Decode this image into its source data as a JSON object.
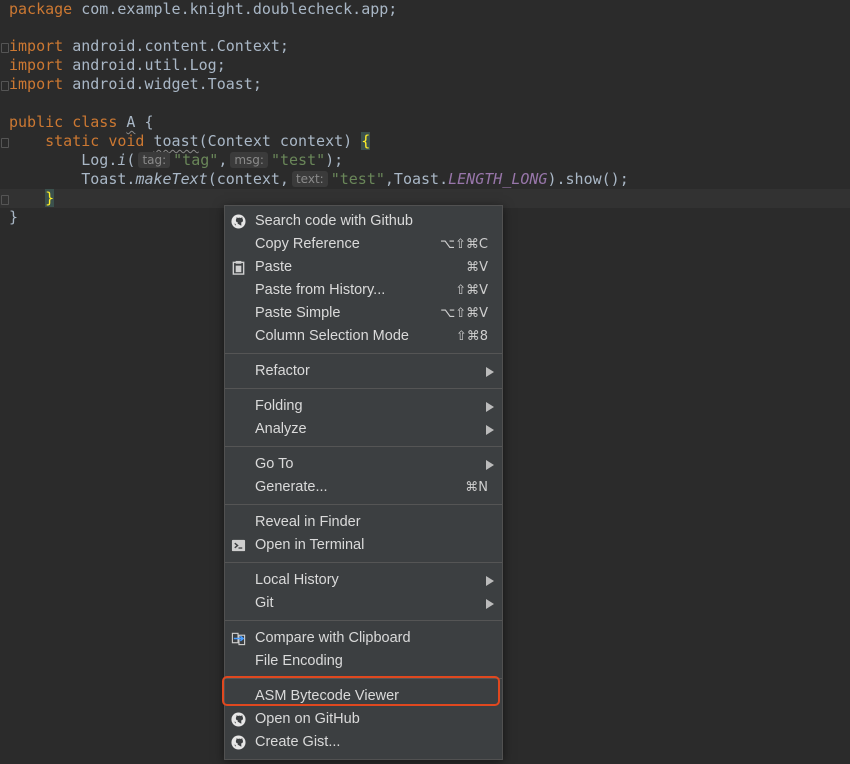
{
  "editor": {
    "line1": {
      "kw": "package",
      "rest": " com.example.knight.doublecheck.app;"
    },
    "imports": [
      {
        "kw": "import",
        "rest": " android.content.Context;"
      },
      {
        "kw": "import",
        "rest": " android.util.Log;"
      },
      {
        "kw": "import",
        "rest": " android.widget.Toast;"
      }
    ],
    "class_line": {
      "kw1": "public",
      "kw2": "class",
      "name": "A",
      "brace": " {"
    },
    "method_line": {
      "kw1": "static",
      "kw2": "void",
      "name": "toast",
      "params": "(Context context) ",
      "brace": "{"
    },
    "log_line": {
      "obj": "Log.",
      "method": "i",
      "open": "(",
      "hint1": "tag:",
      "arg1": "\"tag\"",
      "comma": ",",
      "hint2": "msg:",
      "arg2": "\"test\"",
      "close": ");"
    },
    "toast_line": {
      "obj": "Toast.",
      "method": "makeText",
      "open": "(context,",
      "hint": "text:",
      "arg": "\"test\"",
      "mid": ",Toast.",
      "const": "LENGTH_LONG",
      "close": ").show();"
    },
    "close_method": "}",
    "close_class": "}"
  },
  "menu": {
    "items": [
      {
        "label": "Search code with Github",
        "shortcut": "",
        "icon": "github-icon"
      },
      {
        "label": "Copy Reference",
        "shortcut": "⌥⇧⌘C"
      },
      {
        "label": "Paste",
        "shortcut": "⌘V",
        "icon": "clipboard-icon"
      },
      {
        "label": "Paste from History...",
        "shortcut": "⇧⌘V"
      },
      {
        "label": "Paste Simple",
        "shortcut": "⌥⇧⌘V"
      },
      {
        "label": "Column Selection Mode",
        "shortcut": "⇧⌘8"
      },
      {
        "label": "Refactor",
        "submenu": true
      },
      {
        "label": "Folding",
        "submenu": true
      },
      {
        "label": "Analyze",
        "submenu": true
      },
      {
        "label": "Go To",
        "submenu": true
      },
      {
        "label": "Generate...",
        "shortcut": "⌘N"
      },
      {
        "label": "Reveal in Finder"
      },
      {
        "label": "Open in Terminal",
        "icon": "terminal-icon"
      },
      {
        "label": "Local History",
        "submenu": true
      },
      {
        "label": "Git",
        "submenu": true
      },
      {
        "label": "Compare with Clipboard",
        "icon": "compare-icon"
      },
      {
        "label": "File Encoding"
      },
      {
        "label": "ASM Bytecode Viewer",
        "highlighted": true
      },
      {
        "label": "Open on GitHub",
        "icon": "github-icon"
      },
      {
        "label": "Create Gist...",
        "icon": "github-icon"
      }
    ],
    "highlight_color": "#e0481f"
  }
}
